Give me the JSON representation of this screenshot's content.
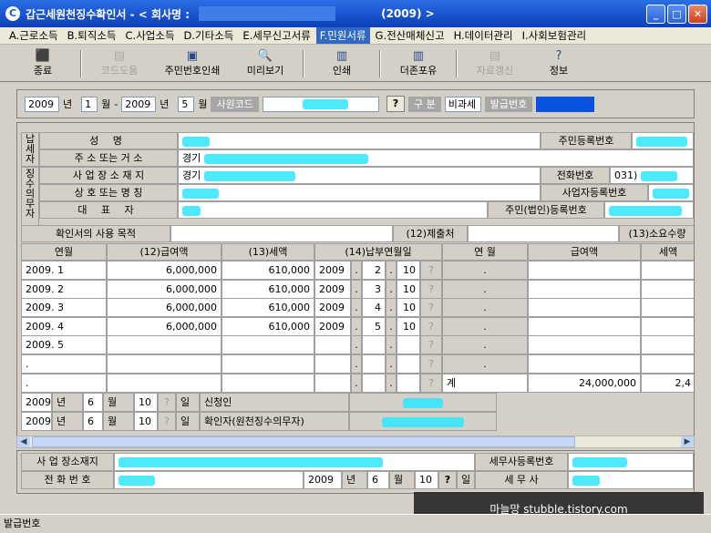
{
  "window": {
    "title_prefix": "갑근세원천징수확인서 - < 회사명 :",
    "title_suffix": "(2009) >",
    "minimize": "_",
    "maximize": "□",
    "close": "✕"
  },
  "menu": [
    "A.근로소득",
    "B.퇴직소득",
    "C.사업소득",
    "D.기타소득",
    "E.세무신고서류",
    "F.민원서류",
    "G.전산매체신고",
    "H.데이터관리",
    "I.사회보험관리"
  ],
  "toolbar": {
    "buttons": [
      {
        "label": "종료",
        "icon": "exit-icon",
        "glyph": "⬛",
        "enabled": true
      },
      {
        "label": "코드도움",
        "icon": "code-help-icon",
        "glyph": "▤",
        "enabled": false
      },
      {
        "label": "주민번호인쇄",
        "icon": "print-id-icon",
        "glyph": "▣",
        "enabled": true
      },
      {
        "label": "미리보기",
        "icon": "preview-icon",
        "glyph": "🔍",
        "enabled": true
      },
      {
        "label": "인쇄",
        "icon": "printer-icon",
        "glyph": "▥",
        "enabled": true
      },
      {
        "label": "더존포유",
        "icon": "douzone-icon",
        "glyph": "▥",
        "enabled": true
      },
      {
        "label": "자료갱신",
        "icon": "refresh-icon",
        "glyph": "▤",
        "enabled": false
      },
      {
        "label": "정보",
        "icon": "info-icon",
        "glyph": "?",
        "enabled": true
      }
    ]
  },
  "filter": {
    "year_from": "2009",
    "year_label": "년",
    "month_from": "1",
    "month_label": "월",
    "dash": "-",
    "year_to": "2009",
    "month_to": "5",
    "employee_code_label": "사원코드",
    "q": "?",
    "category_label": "구  분",
    "category_value": "비과세",
    "issue_no_label": "발급번호"
  },
  "taxpayer": {
    "side_label_1": "납세자",
    "side_label_2": "징수의무자",
    "name_label": "성   명",
    "address_label": "주 소 또는 거 소",
    "address_value": "경기",
    "biz_address_label": "사 업 장 소 재 지",
    "biz_address_value": "경기",
    "trade_name_label": "상 호 또는 명 칭",
    "rep_label": "대   표   자",
    "rrn_label": "주민등록번호",
    "phone_label": "전화번호",
    "phone_value": "031)",
    "biz_reg_label": "사업자등록번호",
    "corp_reg_label": "주민(법인)등록번호",
    "purpose_label": "확인서의  사용  목적",
    "submit_to_label": "(12)제출처",
    "qty_label": "(13)소요수량"
  },
  "table": {
    "headers": [
      "연월",
      "(12)급여액",
      "(13)세액",
      "(14)납부연월일"
    ],
    "headers_right": [
      "연   월",
      "급여액",
      "세액"
    ],
    "rows": [
      {
        "ym": "2009.  1",
        "pay": "6,000,000",
        "tax": "610,000",
        "py": "2009",
        "pm": "2",
        "pd": "10"
      },
      {
        "ym": "2009.  2",
        "pay": "6,000,000",
        "tax": "610,000",
        "py": "2009",
        "pm": "3",
        "pd": "10"
      },
      {
        "ym": "2009.  3",
        "pay": "6,000,000",
        "tax": "610,000",
        "py": "2009",
        "pm": "4",
        "pd": "10"
      },
      {
        "ym": "2009.  4",
        "pay": "6,000,000",
        "tax": "610,000",
        "py": "2009",
        "pm": "5",
        "pd": "10"
      },
      {
        "ym": "2009.  5",
        "pay": "",
        "tax": "",
        "py": "",
        "pm": "",
        "pd": ""
      },
      {
        "ym": ".",
        "pay": "",
        "tax": "",
        "py": "",
        "pm": "",
        "pd": ""
      },
      {
        "ym": ".",
        "pay": "",
        "tax": "",
        "py": "",
        "pm": "",
        "pd": ""
      }
    ],
    "dot": ".",
    "q": "?",
    "total_label": "계",
    "total_pay": "24,000,000",
    "total_tax": "2,4"
  },
  "signature": {
    "row1": {
      "year": "2009",
      "year_label": "년",
      "month": "6",
      "month_label": "월",
      "day": "10",
      "day_label": "일",
      "label": "신청인"
    },
    "row2": {
      "year": "2009",
      "year_label": "년",
      "month": "6",
      "month_label": "월",
      "day": "10",
      "day_label": "일",
      "label": "확인자(원천징수의무자)"
    }
  },
  "bottom": {
    "biz_address_label": "사 업 장소재지",
    "phone_label": "전  화  번  호",
    "year": "2009",
    "year_label": "년",
    "month": "6",
    "month_label": "월",
    "day": "10",
    "day_label": "일",
    "tax_office_no_label": "세무사등록번호",
    "tax_accountant_label": "세 무 사"
  },
  "status": {
    "text": "발급번호"
  },
  "watermark": "마늘망 stubble.tistory.com",
  "colors": {
    "title": "#1a55d0",
    "redaction": "#2ee6ff",
    "issue_no_box": "#0a52e0"
  }
}
